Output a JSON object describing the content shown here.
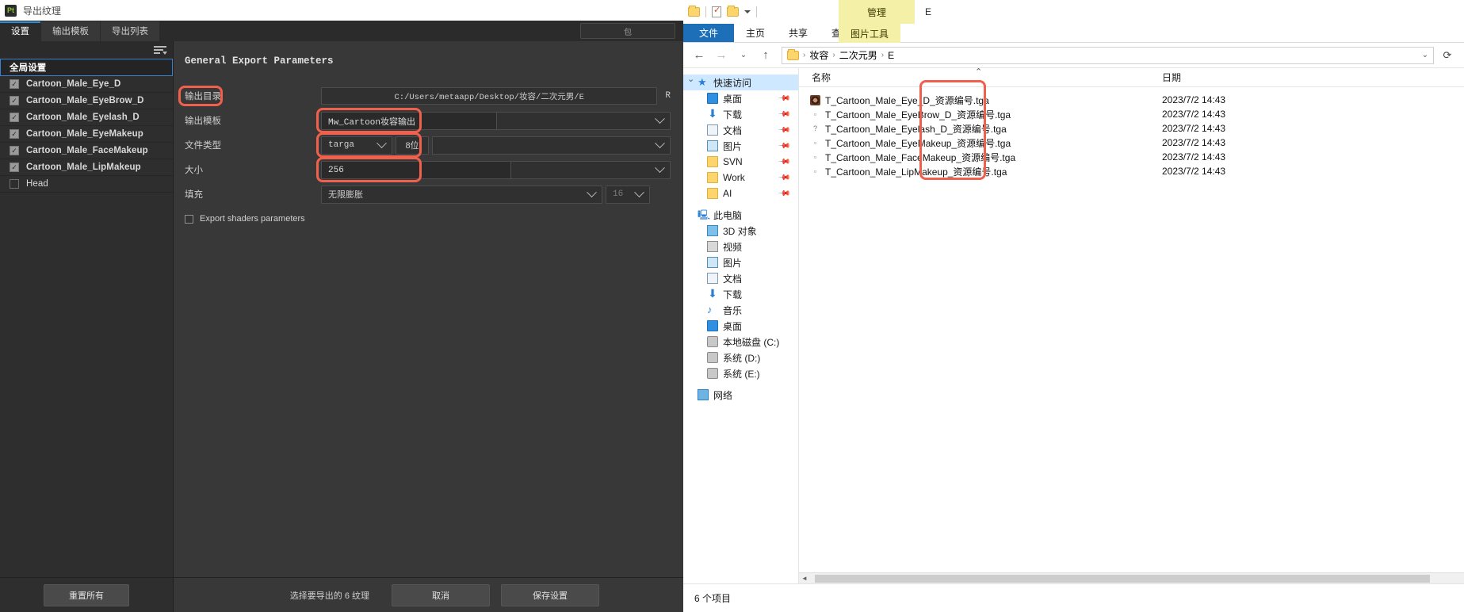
{
  "painter": {
    "title": "导出纹理",
    "logo": "Pt",
    "tabs": [
      {
        "label": "设置",
        "active": true
      },
      {
        "label": "输出模板",
        "active": false
      },
      {
        "label": "导出列表",
        "active": false
      }
    ],
    "search_placeholder": "包",
    "list": {
      "global_label": "全局设置",
      "items": [
        {
          "label": "Cartoon_Male_Eye_D",
          "checked": true
        },
        {
          "label": "Cartoon_Male_EyeBrow_D",
          "checked": true
        },
        {
          "label": "Cartoon_Male_Eyelash_D",
          "checked": true
        },
        {
          "label": "Cartoon_Male_EyeMakeup",
          "checked": true
        },
        {
          "label": "Cartoon_Male_FaceMakeup",
          "checked": true
        },
        {
          "label": "Cartoon_Male_LipMakeup",
          "checked": true
        },
        {
          "label": "Head",
          "checked": false
        }
      ],
      "reset_all_label": "重置所有"
    },
    "form": {
      "section_title": "General Export Parameters",
      "output_dir": {
        "label": "输出目录",
        "value": "C:/Users/metaapp/Desktop/妆容/二次元男/E",
        "suffix": "R"
      },
      "output_template": {
        "label": "输出模板",
        "value": "Mw_Cartoon妆容输出"
      },
      "file_type": {
        "label": "文件类型",
        "value": "targa",
        "bits": "8位"
      },
      "size": {
        "label": "大小",
        "value": "256"
      },
      "padding": {
        "label": "填充",
        "value": "无限膨胀",
        "number": "16"
      },
      "export_shaders": {
        "label": "Export shaders parameters",
        "checked": false
      }
    },
    "footer": {
      "status": "选择要导出的 6 纹理",
      "cancel_label": "取消",
      "save_label": "保存设置"
    },
    "accent_color": "#3a7fd0",
    "annotation_color": "#f0604d"
  },
  "explorer": {
    "quick_access_toolbar": {
      "drive_letter": "E",
      "management_tab": "管理"
    },
    "ribbon_tabs": [
      {
        "label": "文件",
        "kind": "file"
      },
      {
        "label": "主页",
        "kind": "normal"
      },
      {
        "label": "共享",
        "kind": "normal"
      },
      {
        "label": "查看",
        "kind": "normal"
      },
      {
        "label": "图片工具",
        "kind": "context"
      }
    ],
    "address": {
      "crumbs": [
        "妆容",
        "二次元男",
        "E"
      ],
      "separator": "›"
    },
    "nav": {
      "items": [
        {
          "label": "快速访问",
          "icon": "star-icon",
          "level": 1,
          "selected": true,
          "pinned": false
        },
        {
          "label": "桌面",
          "icon": "monitor-icon",
          "level": 2,
          "pinned": true
        },
        {
          "label": "下载",
          "icon": "download-icon",
          "level": 2,
          "pinned": true
        },
        {
          "label": "文档",
          "icon": "documents-icon",
          "level": 2,
          "pinned": true
        },
        {
          "label": "图片",
          "icon": "pictures-icon",
          "level": 2,
          "pinned": true
        },
        {
          "label": "SVN",
          "icon": "folder-icon",
          "level": 2,
          "pinned": true
        },
        {
          "label": "Work",
          "icon": "folder-icon",
          "level": 2,
          "pinned": true
        },
        {
          "label": "AI",
          "icon": "folder-icon",
          "level": 2,
          "pinned": true
        },
        {
          "label": "此电脑",
          "icon": "this-pc-icon",
          "level": 1,
          "pinned": false
        },
        {
          "label": "3D 对象",
          "icon": "cube-icon",
          "level": 2,
          "pinned": false
        },
        {
          "label": "视频",
          "icon": "video-icon",
          "level": 2,
          "pinned": false
        },
        {
          "label": "图片",
          "icon": "pictures-icon",
          "level": 2,
          "pinned": false
        },
        {
          "label": "文档",
          "icon": "documents-icon",
          "level": 2,
          "pinned": false
        },
        {
          "label": "下载",
          "icon": "download-icon",
          "level": 2,
          "pinned": false
        },
        {
          "label": "音乐",
          "icon": "music-icon",
          "level": 2,
          "pinned": false
        },
        {
          "label": "桌面",
          "icon": "monitor-icon",
          "level": 2,
          "pinned": false
        },
        {
          "label": "本地磁盘 (C:)",
          "icon": "disk-icon",
          "level": 2,
          "pinned": false
        },
        {
          "label": "系统 (D:)",
          "icon": "disk-icon",
          "level": 2,
          "pinned": false
        },
        {
          "label": "系统 (E:)",
          "icon": "disk-icon",
          "level": 2,
          "pinned": false
        },
        {
          "label": "网络",
          "icon": "network-icon",
          "level": 1,
          "pinned": false
        }
      ]
    },
    "columns": {
      "name": "名称",
      "date": "日期"
    },
    "files": [
      {
        "name": "T_Cartoon_Male_Eye_D_资源编号.tga",
        "date": "2023/7/2 14:43",
        "icon": "eye-thumb-icon"
      },
      {
        "name": "T_Cartoon_Male_EyeBrow_D_资源编号.tga",
        "date": "2023/7/2 14:43",
        "icon": "image-thumb-icon"
      },
      {
        "name": "T_Cartoon_Male_Eyelash_D_资源编号.tga",
        "date": "2023/7/2 14:43",
        "icon": "image-thumb-icon"
      },
      {
        "name": "T_Cartoon_Male_EyeMakeup_资源编号.tga",
        "date": "2023/7/2 14:43",
        "icon": "image-thumb-icon"
      },
      {
        "name": "T_Cartoon_Male_FaceMakeup_资源编号.tga",
        "date": "2023/7/2 14:43",
        "icon": "image-thumb-icon"
      },
      {
        "name": "T_Cartoon_Male_LipMakeup_资源编号.tga",
        "date": "2023/7/2 14:43",
        "icon": "image-thumb-icon"
      }
    ],
    "status": "6 个项目"
  }
}
